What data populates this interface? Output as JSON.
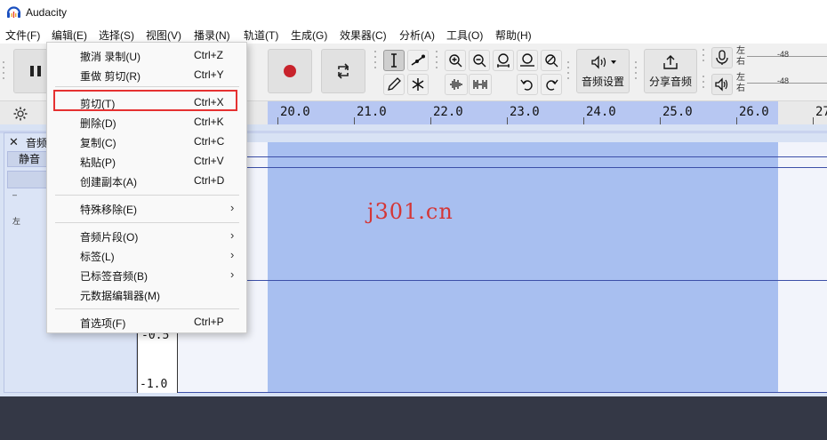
{
  "app": {
    "title": "Audacity"
  },
  "menubar": [
    {
      "label": "文件(F)"
    },
    {
      "label": "编辑(E)"
    },
    {
      "label": "选择(S)"
    },
    {
      "label": "视图(V)"
    },
    {
      "label": "播录(N)"
    },
    {
      "label": "轨道(T)"
    },
    {
      "label": "生成(G)"
    },
    {
      "label": "效果器(C)"
    },
    {
      "label": "分析(A)"
    },
    {
      "label": "工具(O)"
    },
    {
      "label": "帮助(H)"
    }
  ],
  "toolbar": {
    "audio_setup_label": "音频设置",
    "share_audio_label": "分享音频",
    "meter_rec": {
      "left": "左",
      "right": "右",
      "level": "-48"
    },
    "meter_play": {
      "left": "左",
      "right": "右",
      "level": "-48"
    }
  },
  "ruler": {
    "ticks": [
      "20.0",
      "21.0",
      "22.0",
      "23.0",
      "24.0",
      "25.0",
      "26.0",
      "27"
    ]
  },
  "track": {
    "name": "音频",
    "mute_label": "静音",
    "pan_mark": "左",
    "vruler_labels": [
      "-0.5",
      "-1.0"
    ]
  },
  "watermark": "j301.cn",
  "edit_menu": {
    "groups": [
      [
        {
          "label": "撤消 录制(U)",
          "shortcut": "Ctrl+Z"
        },
        {
          "label": "重做 剪切(R)",
          "shortcut": "Ctrl+Y"
        }
      ],
      [
        {
          "label": "剪切(T)",
          "shortcut": "Ctrl+X",
          "highlighted": true
        },
        {
          "label": "删除(D)",
          "shortcut": "Ctrl+K"
        },
        {
          "label": "复制(C)",
          "shortcut": "Ctrl+C"
        },
        {
          "label": "粘贴(P)",
          "shortcut": "Ctrl+V"
        },
        {
          "label": "创建副本(A)",
          "shortcut": "Ctrl+D"
        }
      ],
      [
        {
          "label": "特殊移除(E)",
          "shortcut": ""
        }
      ],
      [
        {
          "label": "音频片段(O)",
          "shortcut": ""
        },
        {
          "label": "标签(L)",
          "shortcut": ""
        },
        {
          "label": "已标签音频(B)",
          "shortcut": ""
        },
        {
          "label": "元数据编辑器(M)",
          "shortcut": ""
        }
      ],
      [
        {
          "label": "首选项(F)",
          "shortcut": "Ctrl+P"
        }
      ]
    ],
    "highlight_color": "#e53131"
  },
  "colors": {
    "selection": "#a8bff0",
    "ruler_selection": "#b7c7f2",
    "record_red": "#c8232c"
  }
}
